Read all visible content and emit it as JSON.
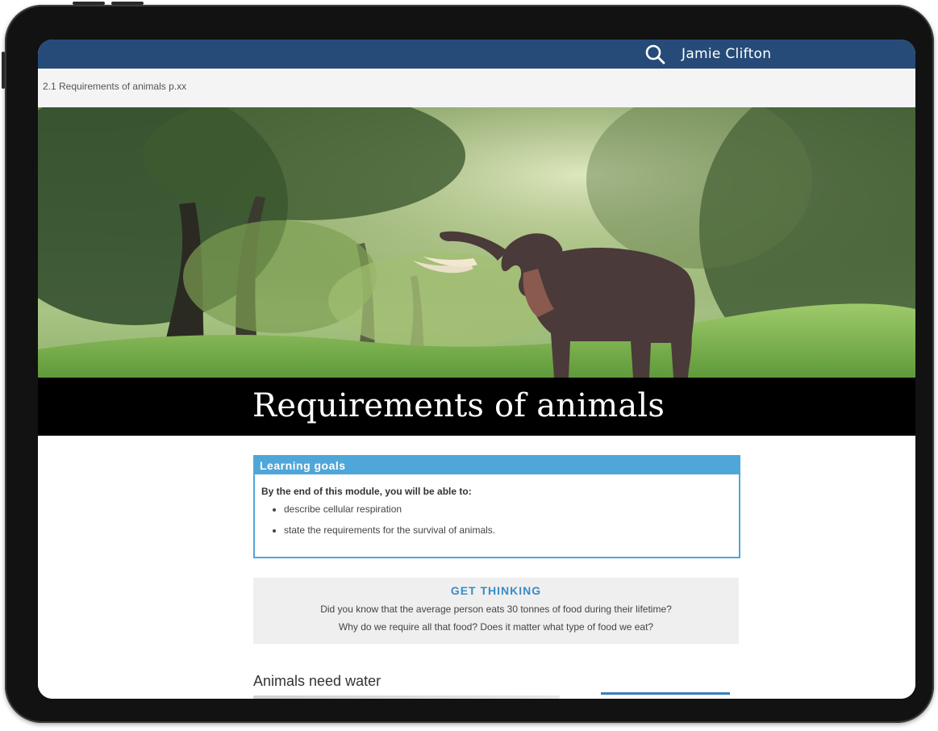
{
  "topbar": {
    "user_name": "Jamie Clifton",
    "search_icon": "search-icon",
    "color": "#264b78"
  },
  "breadcrumb": {
    "text": "2.1 Requirements of animals p.xx"
  },
  "hero": {
    "image": "elephant-in-forest",
    "title": "Requirements of animals"
  },
  "learning_goals": {
    "header": "Learning goals",
    "intro": "By the end of this module, you will be able to:",
    "items": [
      "describe cellular respiration",
      "state the requirements for the survival of animals."
    ],
    "accent": "#4fa6d8"
  },
  "get_thinking": {
    "title": "GET THINKING",
    "lines": [
      "Did you know that the average person eats 30 tonnes of food during their lifetime?",
      "Why do we require all that food? Does it matter what type of food we eat?"
    ]
  },
  "section": {
    "heading": "Animals need water"
  }
}
